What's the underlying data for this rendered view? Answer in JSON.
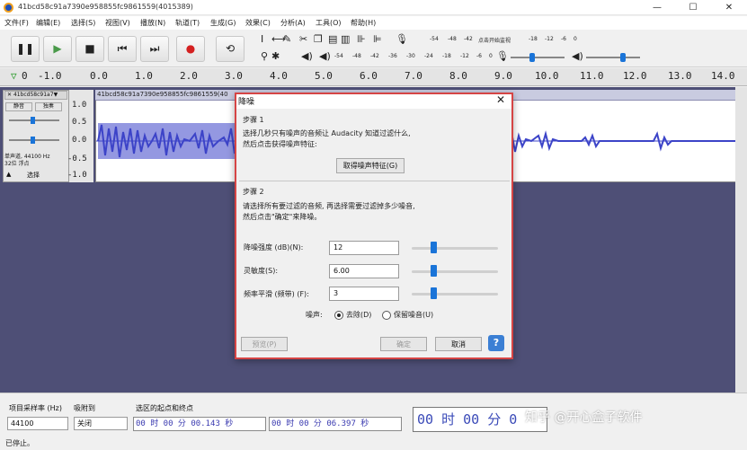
{
  "window": {
    "title": "41bcd58c91a7390e958855fc9861559(4015389)",
    "minimize": "—",
    "maximize": "☐",
    "close": "✕"
  },
  "menu": [
    "文件(F)",
    "编辑(E)",
    "选择(S)",
    "视图(V)",
    "播放(N)",
    "轨道(T)",
    "生成(G)",
    "效果(C)",
    "分析(A)",
    "工具(O)",
    "帮助(H)"
  ],
  "transport": {
    "pause": "❚❚",
    "play": "▶",
    "stop": "■",
    "skip_start": "⏮",
    "skip_end": "⏭",
    "record": "●",
    "loop": "⟲"
  },
  "meters": {
    "record_hint": "点击开始监视",
    "record_ticks": [
      "-54",
      "-48",
      "-42",
      "-18",
      "-12",
      "-6",
      "0"
    ],
    "play_ticks": [
      "-54",
      "-48",
      "-42",
      "-36",
      "-30",
      "-24",
      "-18",
      "-12",
      "-6",
      "0"
    ]
  },
  "ruler": {
    "ticks": [
      "0",
      "-1.0",
      "0.0",
      "1.0",
      "2.0",
      "3.0",
      "4.0",
      "5.0",
      "6.0",
      "7.0",
      "8.0",
      "9.0",
      "10.0",
      "11.0",
      "12.0",
      "13.0",
      "14.0"
    ]
  },
  "track": {
    "name": "41bcd58c91a7",
    "mute": "静音",
    "solo": "独奏",
    "info": "单声道, 44100 Hz",
    "info2": "32位 浮点",
    "collapse": "▲",
    "select": "选择",
    "scale": [
      "1.0",
      "0.5",
      "0.0",
      "-0.5",
      "-1.0"
    ],
    "clip_name": "41bcd58c91a7390e958855fc9861559(40"
  },
  "dialog": {
    "title": "降噪",
    "close": "✕",
    "step1_label": "步骤 1",
    "step1_text1": "选择几秒只有噪声的音频让 Audacity 知道过滤什么,",
    "step1_text2": "然后点击获得噪声特征:",
    "get_profile": "取得噪声特征(G)",
    "step2_label": "步骤 2",
    "step2_text1": "请选择所有要过滤的音频, 再选择需要过滤掉多少噪音,",
    "step2_text2": "然后点击\"确定\"来降噪。",
    "reduction_label": "降噪强度 (dB)(N):",
    "reduction_value": "12",
    "sensitivity_label": "灵敏度(S):",
    "sensitivity_value": "6.00",
    "smoothing_label": "频率平滑 (频带) (F):",
    "smoothing_value": "3",
    "noise_label": "噪声:",
    "remove": "去除(D)",
    "residue": "保留噪音(U)",
    "preview": "预览(P)",
    "ok": "确定",
    "cancel": "取消",
    "help": "?"
  },
  "bottom": {
    "rate_label": "项目采样率 (Hz)",
    "snap_label": "吸附到",
    "selection_label": "选区的起点和终点",
    "rate_value": "44100",
    "snap_value": "关闭",
    "start_time": "00 时 00 分 00.143 秒",
    "end_time": "00 时 00 分 06.397 秒",
    "big_time": "00 时 00 分 0",
    "status": "已停止。"
  },
  "watermark": "知乎 @开心盒子软件",
  "colors": {
    "track_bg": "#4e4f76",
    "wave": "#3c44c8",
    "dialog_border": "#d64545",
    "slider": "#1a74d8"
  }
}
